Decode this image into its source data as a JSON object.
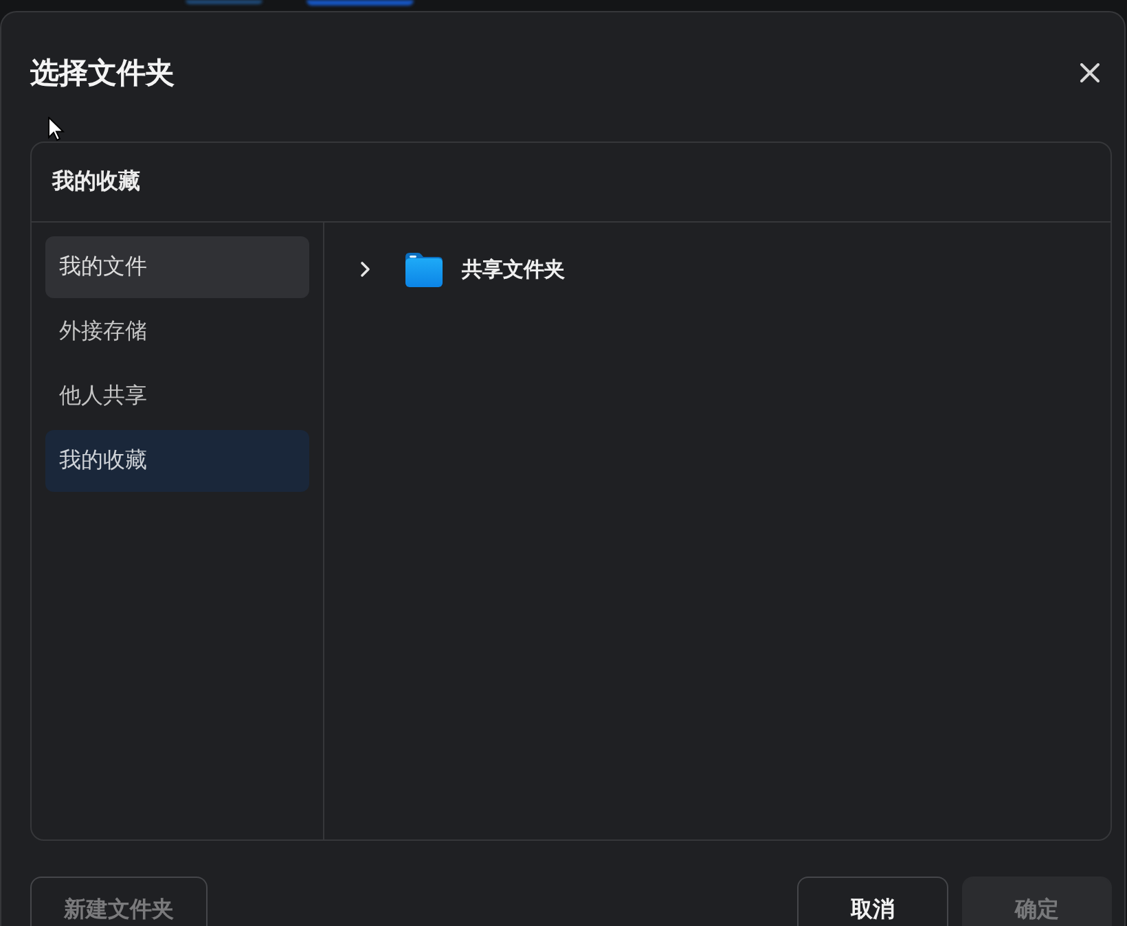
{
  "dialog": {
    "title": "选择文件夹"
  },
  "panel": {
    "heading": "我的收藏"
  },
  "sidebar": {
    "items": [
      {
        "label": "我的文件",
        "selected": false,
        "hovered": true
      },
      {
        "label": "外接存储",
        "selected": false,
        "hovered": false
      },
      {
        "label": "他人共享",
        "selected": false,
        "hovered": false
      },
      {
        "label": "我的收藏",
        "selected": true,
        "hovered": false
      }
    ]
  },
  "tree": [
    {
      "name": "共享文件夹",
      "expanded": false
    }
  ],
  "footer": {
    "new_folder_button": {
      "label": "新建文件夹",
      "disabled": true
    },
    "cancel_button": {
      "label": "取消",
      "disabled": false
    },
    "confirm_button": {
      "label": "确定",
      "disabled": true
    }
  }
}
